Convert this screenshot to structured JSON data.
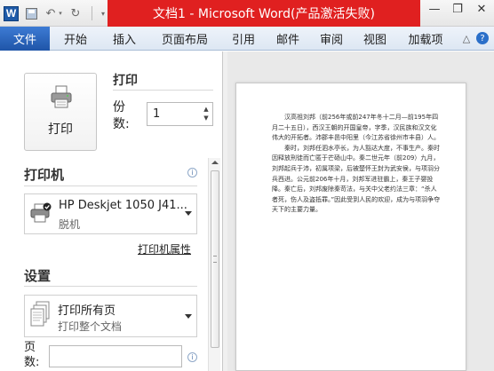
{
  "titlebar": {
    "app_icon": "W",
    "title": "文档1 - Microsoft Word(产品激活失败)",
    "qat_icons": [
      "save-icon",
      "undo-icon",
      "redo-icon",
      "customize-qat-icon"
    ],
    "window_controls": [
      "minimize-icon",
      "restore-icon",
      "close-icon"
    ],
    "accent_color": "#e02020"
  },
  "ribbon": {
    "tabs": [
      "文件",
      "开始",
      "插入",
      "页面布局",
      "引用",
      "邮件",
      "审阅",
      "视图",
      "加载项"
    ],
    "file_tab_color": "#2b66bd"
  },
  "print": {
    "button_label": "打印",
    "heading": "打印",
    "copies_label": "份数:",
    "copies_value": "1"
  },
  "printer": {
    "heading": "打印机",
    "name": "HP Deskjet 1050 J41...",
    "status": "脱机",
    "properties_link": "打印机属性"
  },
  "settings": {
    "heading": "设置",
    "scope_main": "打印所有页",
    "scope_sub": "打印整个文档",
    "pages_label": "页数:",
    "pages_value": ""
  },
  "preview": {
    "paragraphs": [
      "汉高祖刘邦（前256年或前247年冬十二月—前195年四月二十五日），西汉王朝的开国皇帝，字季，汉民族和汉文化伟大的开拓者。沛郡丰邑中阳里（今江苏省徐州市丰县）人。",
      "秦时，刘邦任泗水亭长，为人豁达大度，不事生产。秦时因释放刑徒而亡匿于芒砀山中。秦二世元年（前209）九月，刘邦起兵于沛，初属项梁，后被楚怀王封为武安侯，与项羽分兵西进。公元前206年十月，刘邦军进驻霸上，秦王子婴投降。秦亡后，刘邦废除秦苛法，与关中父老约法三章：“杀人者死，伤人及盗抵罪。”因此受到人民的欢迎，成为与项羽争夺天下的主要力量。"
    ]
  }
}
